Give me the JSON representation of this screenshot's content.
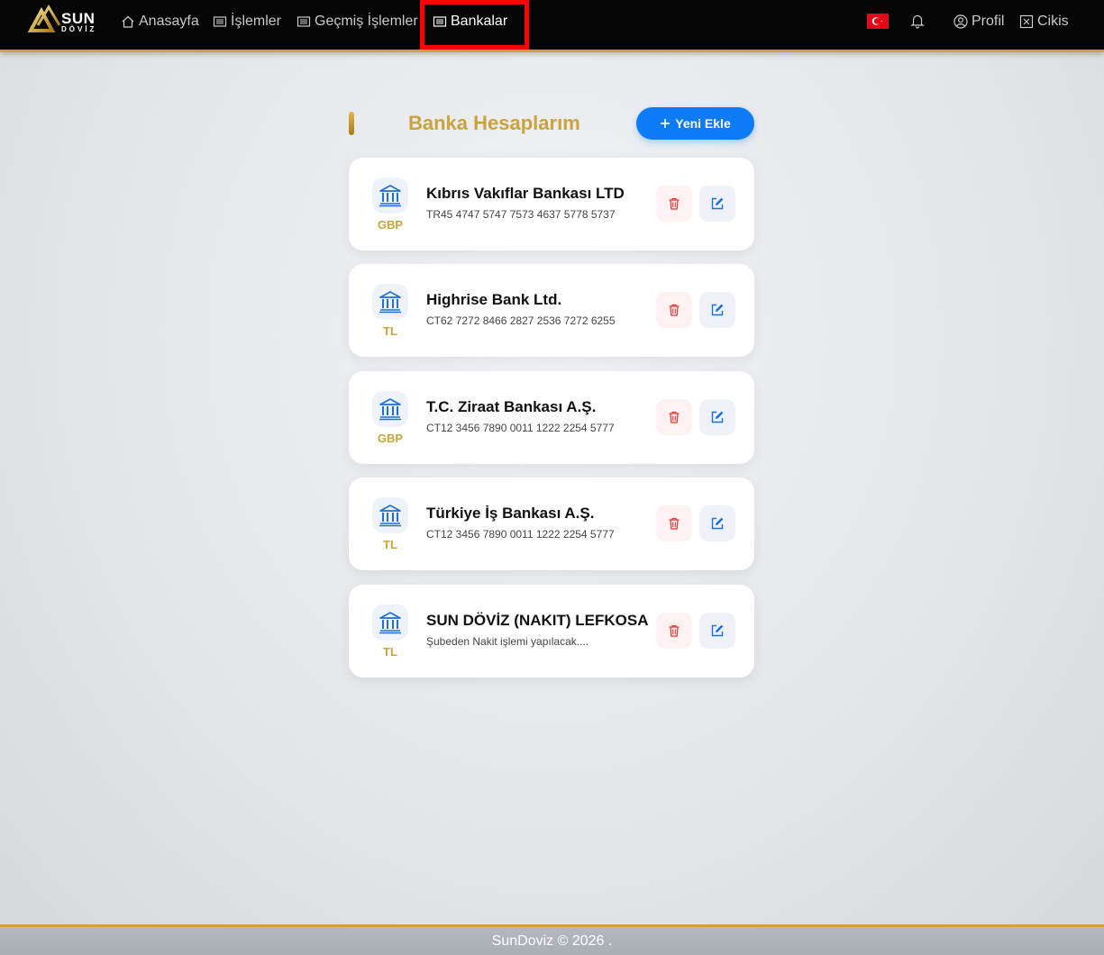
{
  "brand": {
    "name_top": "SUN",
    "name_bottom": "DÖVİZ"
  },
  "nav": {
    "items": [
      {
        "label": "Anasayfa",
        "icon": "home-icon"
      },
      {
        "label": "İşlemler",
        "icon": "list-icon"
      },
      {
        "label": "Geçmiş İşlemler",
        "icon": "list-icon"
      },
      {
        "label": "Bankalar",
        "icon": "list-icon",
        "active": true
      }
    ],
    "language_flag": "tr",
    "profile_label": "Profil",
    "logout_label": "Cikis"
  },
  "main": {
    "title": "Banka Hesaplarım",
    "add_button_label": "Yeni Ekle",
    "accounts": [
      {
        "currency": "GBP",
        "bank_name": "Kıbrıs Vakıflar Bankası LTD",
        "iban": "TR45 4747 5747 7573 4637 5778 5737"
      },
      {
        "currency": "TL",
        "bank_name": "Highrise Bank Ltd.",
        "iban": "CT62 7272 8466 2827 2536 7272 6255"
      },
      {
        "currency": "GBP",
        "bank_name": "T.C. Ziraat Bankası A.Ş.",
        "iban": "CT12 3456 7890 0011 1222 2254 5777"
      },
      {
        "currency": "TL",
        "bank_name": "Türkiye İş Bankası A.Ş.",
        "iban": "CT12 3456 7890 0011 1222 2254 5777"
      },
      {
        "currency": "TL",
        "bank_name": "SUN DÖVİZ (NAKIT) LEFKOSA",
        "iban": "Şubeden Nakit işlemi yapılacak...."
      }
    ]
  },
  "footer": {
    "text": "SunDoviz © 2026 ."
  },
  "colors": {
    "accent_gold": "#c9a43e",
    "primary_blue": "#0d7bf5",
    "delete_red": "#e53935",
    "highlight_red": "#ff0000"
  }
}
